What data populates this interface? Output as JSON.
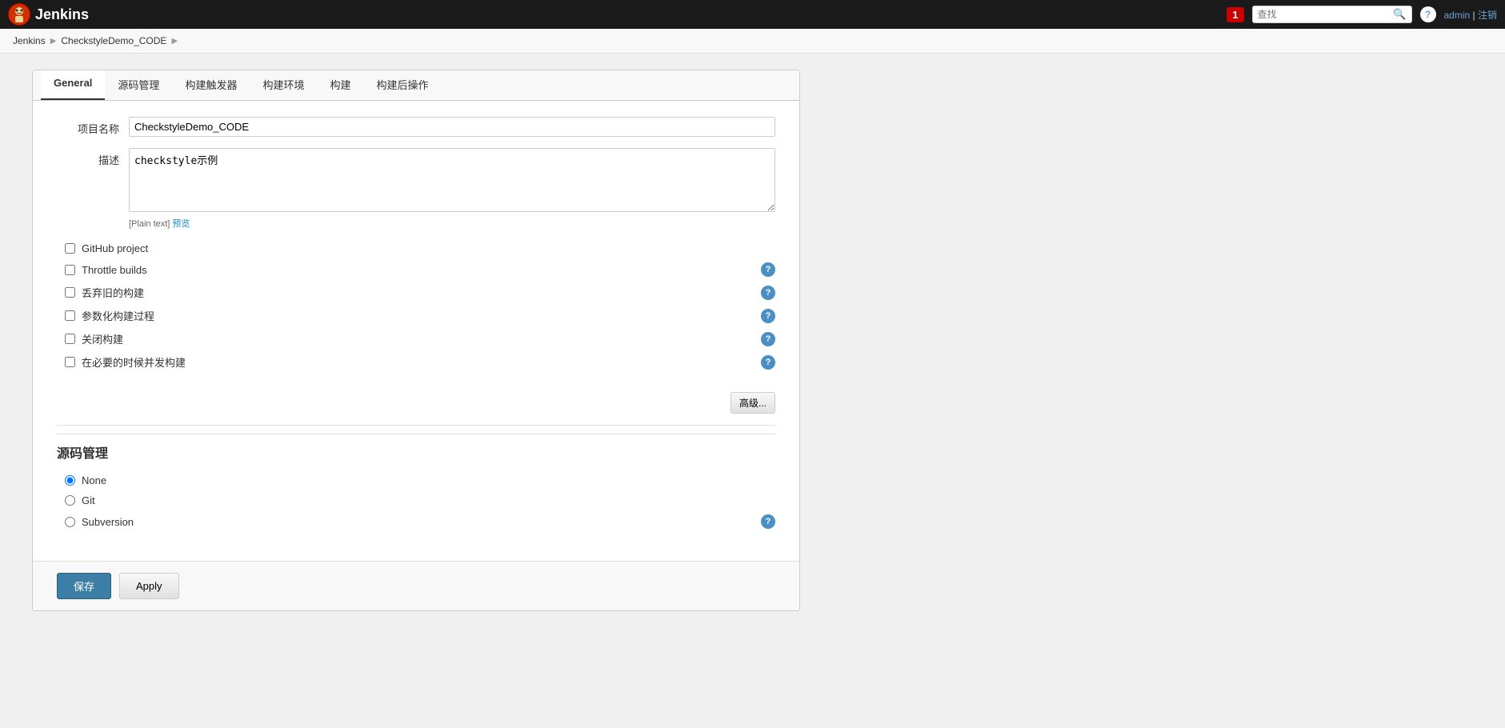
{
  "app": {
    "name": "Jenkins",
    "logo_text": "J"
  },
  "navbar": {
    "notification_count": "1",
    "search_placeholder": "查找",
    "help_icon": "?",
    "user": "admin",
    "logout": "注销"
  },
  "breadcrumb": {
    "home": "Jenkins",
    "project": "CheckstyleDemo_CODE"
  },
  "tabs": [
    {
      "id": "general",
      "label": "General",
      "active": true
    },
    {
      "id": "source",
      "label": "源码管理"
    },
    {
      "id": "triggers",
      "label": "构建触发器"
    },
    {
      "id": "env",
      "label": "构建环境"
    },
    {
      "id": "build",
      "label": "构建"
    },
    {
      "id": "post",
      "label": "构建后操作"
    }
  ],
  "form": {
    "project_name_label": "项目名称",
    "project_name_value": "CheckstyleDemo_CODE",
    "description_label": "描述",
    "description_value": "checkstyle示例",
    "plain_text": "[Plain text]",
    "preview": "预览"
  },
  "checkboxes": [
    {
      "id": "github",
      "label": "GitHub project",
      "checked": false,
      "help": true
    },
    {
      "id": "throttle",
      "label": "Throttle builds",
      "checked": false,
      "help": true
    },
    {
      "id": "discard",
      "label": "丢弃旧的构建",
      "checked": false,
      "help": true
    },
    {
      "id": "param",
      "label": "参数化构建过程",
      "checked": false,
      "help": true
    },
    {
      "id": "disable",
      "label": "关闭构建",
      "checked": false,
      "help": true
    },
    {
      "id": "concurrent",
      "label": "在必要的时候并发构建",
      "checked": false,
      "help": true
    }
  ],
  "advanced_button": "高级...",
  "source_section": {
    "title": "源码管理",
    "radios": [
      {
        "id": "none",
        "label": "None",
        "checked": true
      },
      {
        "id": "git",
        "label": "Git",
        "checked": false
      },
      {
        "id": "svn",
        "label": "Subversion",
        "checked": false,
        "help": true
      }
    ]
  },
  "buttons": {
    "save": "保存",
    "apply": "Apply"
  }
}
